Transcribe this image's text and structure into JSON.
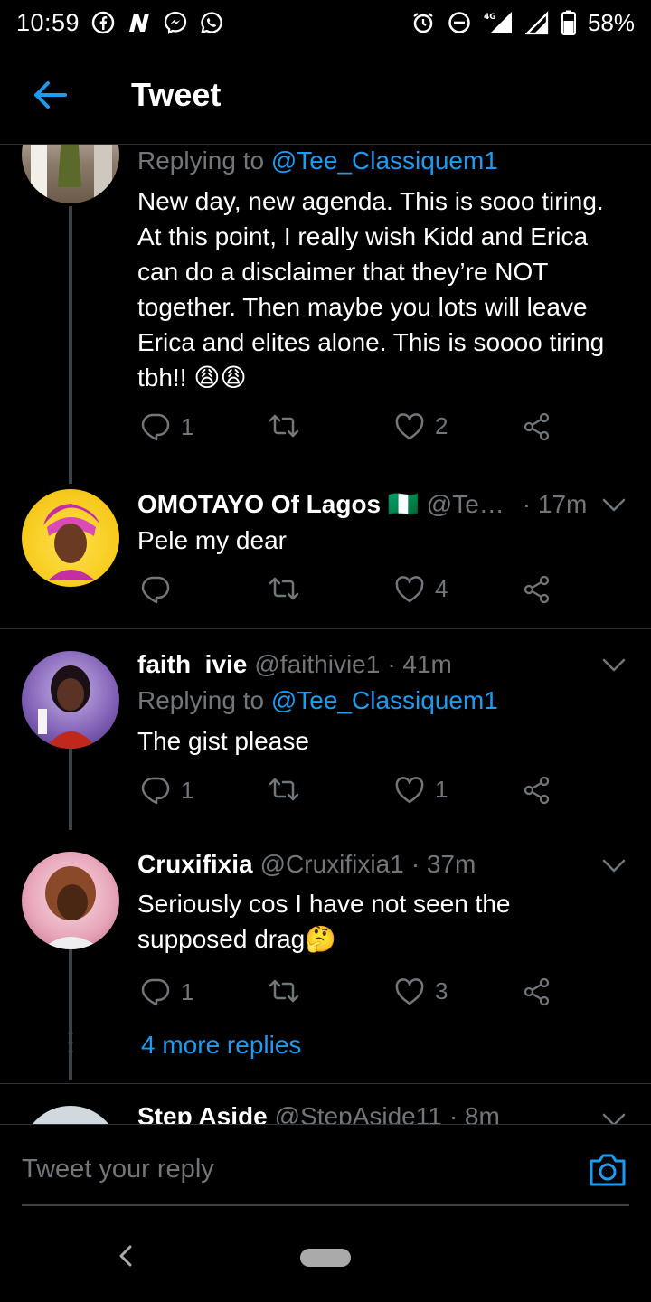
{
  "status_bar": {
    "time": "10:59",
    "icons": [
      "facebook-icon",
      "n-app-icon",
      "messenger-icon",
      "whatsapp-icon",
      "alarm-icon",
      "dnd-icon",
      "4g-signal-icon",
      "signal-icon",
      "battery-icon"
    ],
    "network_label": "4G",
    "battery_text": "58%"
  },
  "header": {
    "title": "Tweet"
  },
  "tweets": [
    {
      "reply_prefix": "Replying to",
      "reply_handle": "@Tee_Classiquem1",
      "text": "New day, new agenda. This is sooo tiring. At this point, I really wish Kidd and Erica can do a disclaimer that they’re NOT together. Then maybe you lots will leave Erica and elites alone. This is soooo tiring tbh!! 😩😩",
      "counts": {
        "replies": "1",
        "retweets": "",
        "likes": "2"
      }
    },
    {
      "name": "OMOTAYO Of Lagos 🇳🇬",
      "handle": "@Te…",
      "time": "· 17m",
      "text": "Pele my dear",
      "counts": {
        "replies": "",
        "retweets": "",
        "likes": "4"
      }
    },
    {
      "name": "faith  ivie",
      "handle": "@faithivie1",
      "time": "· 41m",
      "reply_prefix": "Replying to",
      "reply_handle": "@Tee_Classiquem1",
      "text": "The gist please",
      "counts": {
        "replies": "1",
        "retweets": "",
        "likes": "1"
      }
    },
    {
      "name": "Cruxifixia",
      "handle": "@Cruxifixia1",
      "time": "· 37m",
      "text": "Seriously cos I have not seen the supposed drag🤔",
      "counts": {
        "replies": "1",
        "retweets": "",
        "likes": "3"
      },
      "more_replies": "4 more replies"
    },
    {
      "name": "Step Aside",
      "handle": "@StepAside11",
      "time": "· 8m"
    }
  ],
  "reply_bar": {
    "placeholder": "Tweet your reply"
  },
  "colors": {
    "background": "#000000",
    "accent": "#1d9bf0",
    "muted": "#71767b",
    "divider": "#2f3336"
  }
}
